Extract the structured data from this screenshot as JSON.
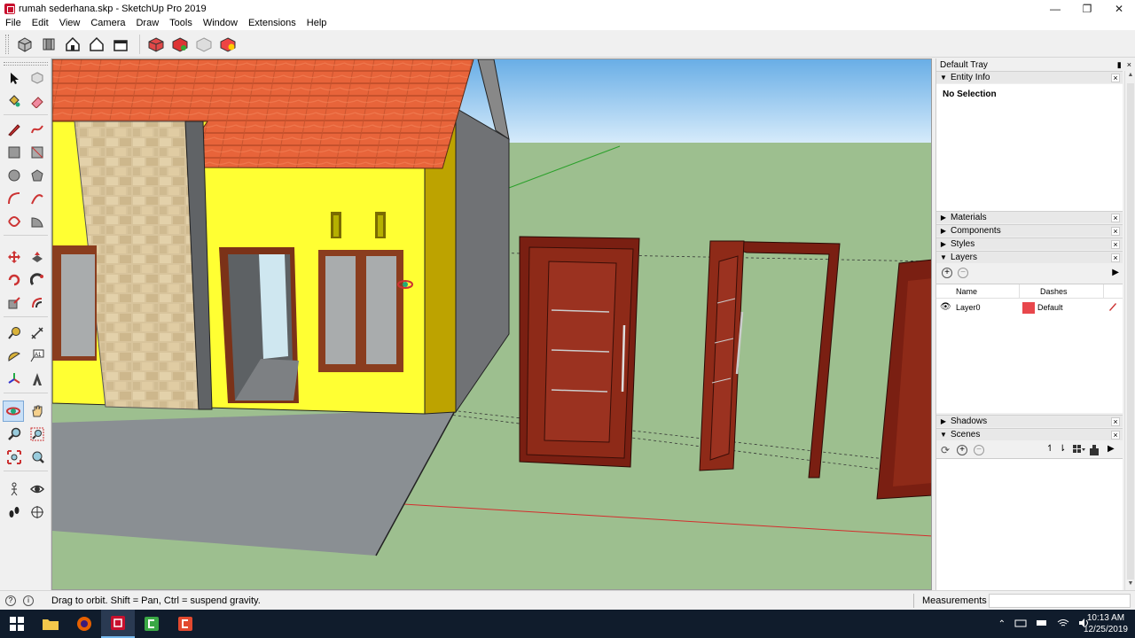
{
  "window": {
    "title": "rumah sederhana.skp - SketchUp Pro 2019",
    "minimize": "—",
    "maximize": "❐",
    "close": "✕"
  },
  "menu": [
    "File",
    "Edit",
    "View",
    "Camera",
    "Draw",
    "Tools",
    "Window",
    "Extensions",
    "Help"
  ],
  "tray": {
    "title": "Default Tray",
    "pin": "▮",
    "close": "×",
    "entity_info": {
      "label": "Entity Info",
      "selection": "No Selection"
    },
    "panels": {
      "materials": "Materials",
      "components": "Components",
      "styles": "Styles",
      "layers": "Layers",
      "shadows": "Shadows",
      "scenes": "Scenes"
    },
    "layers_table": {
      "col_name": "Name",
      "col_dashes": "Dashes",
      "row_name": "Layer0",
      "row_dashes": "Default",
      "row_color": "#e8474c"
    }
  },
  "status": {
    "message": "Drag to orbit. Shift = Pan, Ctrl = suspend gravity.",
    "measurements_label": "Measurements"
  },
  "taskbar": {
    "time": "10:13 AM",
    "date": "12/25/2019"
  },
  "colors": {
    "sky_top": "#6fb0e8",
    "ground": "#9dbf8f",
    "wall_yellow": "#ffff33",
    "roof": "#e8643a",
    "door": "#7a1f12",
    "accent": "#c8102e"
  }
}
